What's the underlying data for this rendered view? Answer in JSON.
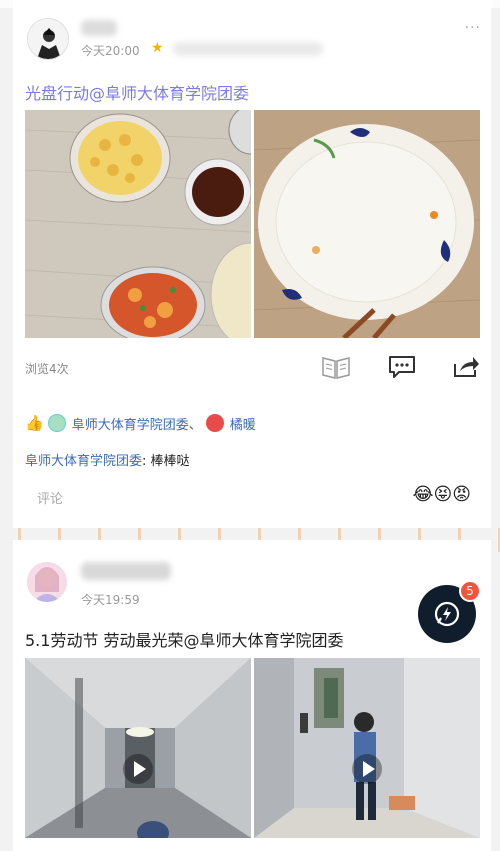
{
  "post1": {
    "timestamp": "今天20:00",
    "title": "光盘行动@阜师大体育学院团委",
    "views": "浏览4次",
    "likes": {
      "names": "阜师大体育学院团委、",
      "second": "橘暖"
    },
    "comment": {
      "author": "阜师大体育学院团委",
      "text": "棒棒哒"
    },
    "comment_placeholder": "评论",
    "emoji_strip": "😂😝😡"
  },
  "post2": {
    "timestamp": "今天19:59",
    "title": "5.1劳动节 劳动最光荣@阜师大体育学院团委"
  },
  "fab": {
    "badge": "5"
  },
  "more_glyph": "···"
}
